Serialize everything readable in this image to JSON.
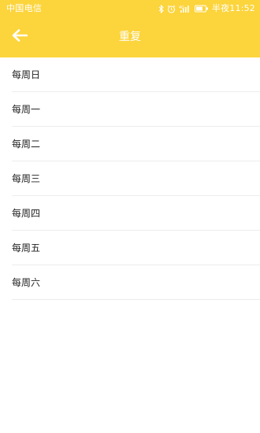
{
  "status_bar": {
    "carrier": "中国电信",
    "time": "半夜11:52",
    "icons": [
      "bluetooth-icon",
      "alarm-icon",
      "signal-icon",
      "battery-icon"
    ]
  },
  "toolbar": {
    "title": "重复",
    "back_icon": "arrow-left-icon"
  },
  "colors": {
    "header": "#fcd43c",
    "header_text": "#ffffff",
    "list_text": "#222222",
    "divider": "#ececec"
  },
  "repeat_list": {
    "items": [
      {
        "label": "每周日"
      },
      {
        "label": "每周一"
      },
      {
        "label": "每周二"
      },
      {
        "label": "每周三"
      },
      {
        "label": "每周四"
      },
      {
        "label": "每周五"
      },
      {
        "label": "每周六"
      }
    ]
  }
}
